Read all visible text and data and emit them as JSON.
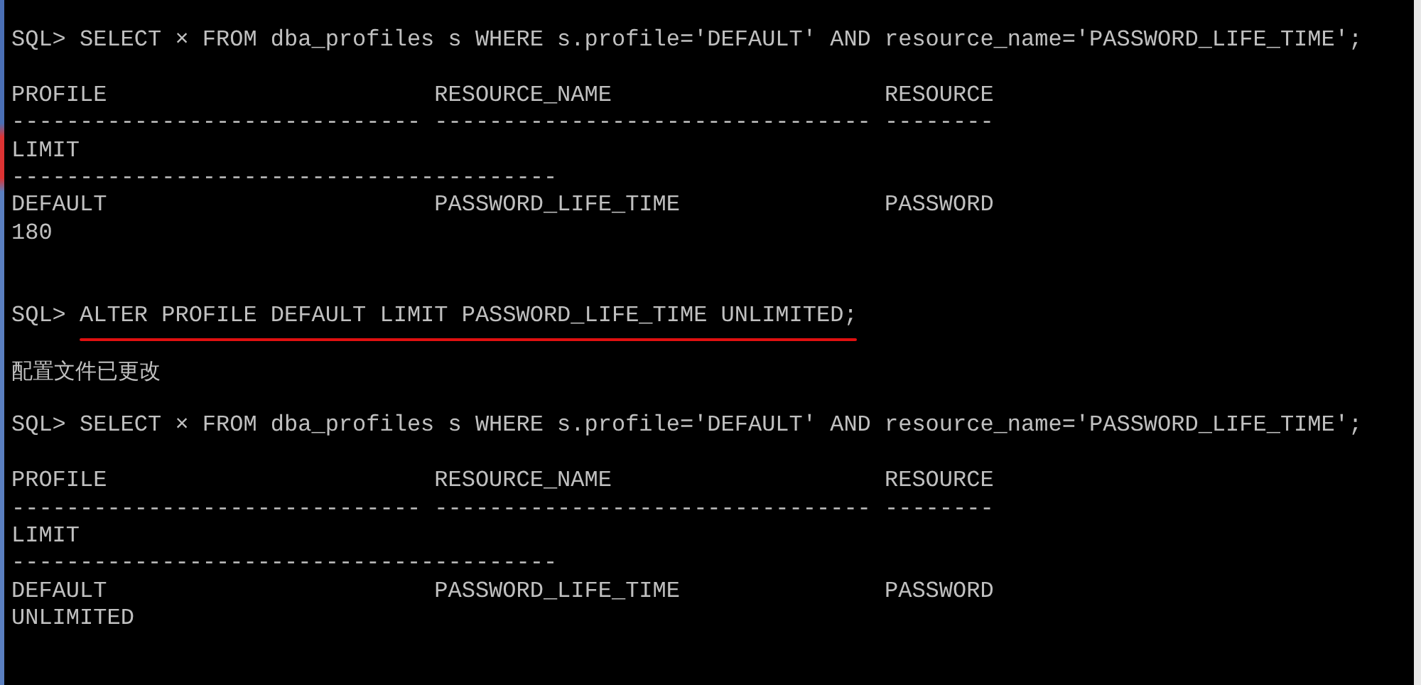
{
  "console": {
    "lines": [
      {
        "kind": "command",
        "prompt": "SQL>",
        "command": "SELECT × FROM dba_profiles s WHERE s.profile='DEFAULT' AND resource_name='PASSWORD_LIFE_TIME';",
        "underlined": false
      },
      {
        "kind": "blank"
      },
      {
        "kind": "row",
        "cells": [
          "PROFILE",
          "RESOURCE_NAME",
          "RESOURCE"
        ]
      },
      {
        "kind": "row",
        "cells": [
          "------------------------------",
          "--------------------------------",
          "--------"
        ]
      },
      {
        "kind": "row",
        "cells": [
          "LIMIT"
        ]
      },
      {
        "kind": "row",
        "cells": [
          "----------------------------------------"
        ]
      },
      {
        "kind": "row",
        "cells": [
          "DEFAULT",
          "PASSWORD_LIFE_TIME",
          "PASSWORD"
        ]
      },
      {
        "kind": "row",
        "cells": [
          "180"
        ]
      },
      {
        "kind": "blank"
      },
      {
        "kind": "blank"
      },
      {
        "kind": "command",
        "prompt": "SQL>",
        "command": "ALTER PROFILE DEFAULT LIMIT PASSWORD_LIFE_TIME UNLIMITED;",
        "underlined": true
      },
      {
        "kind": "blank"
      },
      {
        "kind": "message",
        "text": "配置文件已更改"
      },
      {
        "kind": "blank"
      },
      {
        "kind": "command",
        "prompt": "SQL>",
        "command": "SELECT × FROM dba_profiles s WHERE s.profile='DEFAULT' AND resource_name='PASSWORD_LIFE_TIME';",
        "underlined": false
      },
      {
        "kind": "blank"
      },
      {
        "kind": "row",
        "cells": [
          "PROFILE",
          "RESOURCE_NAME",
          "RESOURCE"
        ]
      },
      {
        "kind": "row",
        "cells": [
          "------------------------------",
          "--------------------------------",
          "--------"
        ]
      },
      {
        "kind": "row",
        "cells": [
          "LIMIT"
        ]
      },
      {
        "kind": "row",
        "cells": [
          "----------------------------------------"
        ]
      },
      {
        "kind": "row",
        "cells": [
          "DEFAULT",
          "PASSWORD_LIFE_TIME",
          "PASSWORD"
        ]
      },
      {
        "kind": "row",
        "cells": [
          "UNLIMITED"
        ]
      }
    ]
  }
}
